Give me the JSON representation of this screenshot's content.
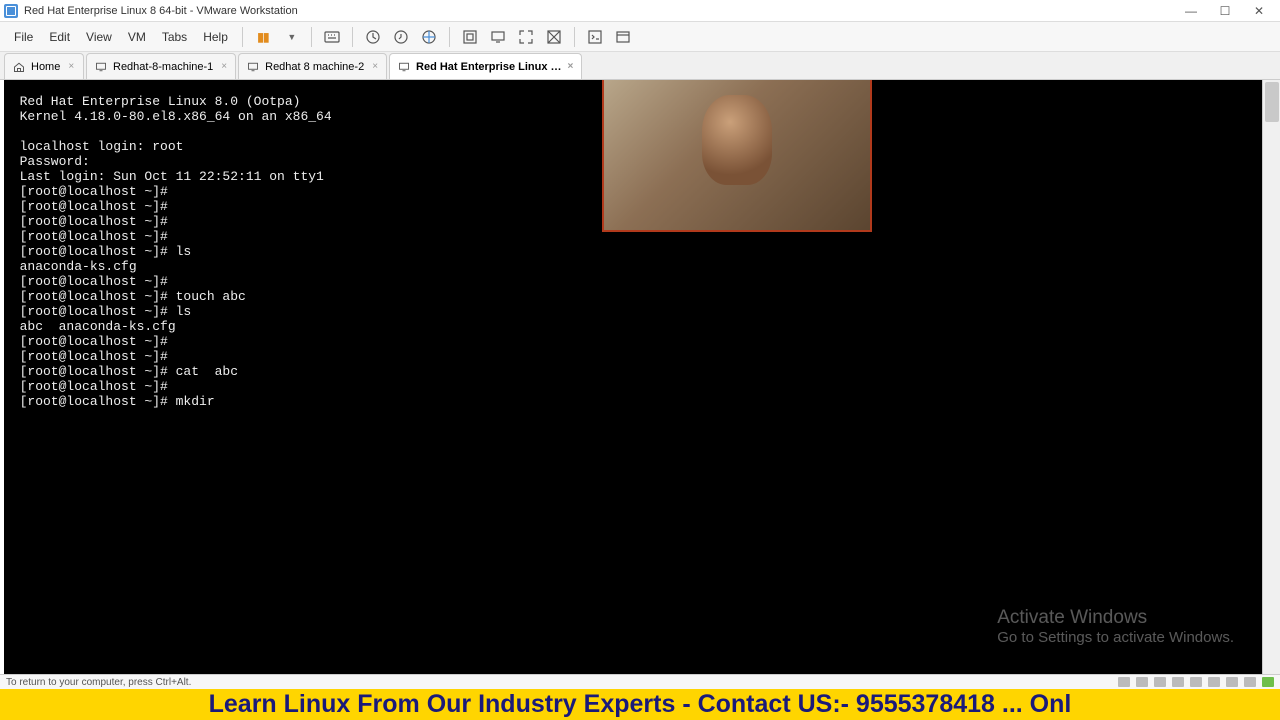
{
  "window_title": "Red Hat Enterprise Linux 8 64-bit - VMware Workstation",
  "menu": {
    "file": "File",
    "edit": "Edit",
    "view": "View",
    "vm": "VM",
    "tabs": "Tabs",
    "help": "Help"
  },
  "tabs": {
    "home": "Home",
    "t1": "Redhat-8-machine-1",
    "t2": "Redhat 8 machine-2",
    "t3": "Red Hat Enterprise Linux …"
  },
  "terminal": [
    "Red Hat Enterprise Linux 8.0 (Ootpa)",
    "Kernel 4.18.0-80.el8.x86_64 on an x86_64",
    "",
    "localhost login: root",
    "Password:",
    "Last login: Sun Oct 11 22:52:11 on tty1",
    "[root@localhost ~]#",
    "[root@localhost ~]#",
    "[root@localhost ~]#",
    "[root@localhost ~]#",
    "[root@localhost ~]# ls",
    "anaconda-ks.cfg",
    "[root@localhost ~]#",
    "[root@localhost ~]# touch abc",
    "[root@localhost ~]# ls",
    "abc  anaconda-ks.cfg",
    "[root@localhost ~]#",
    "[root@localhost ~]#",
    "[root@localhost ~]# cat  abc",
    "[root@localhost ~]#",
    "[root@localhost ~]# mkdir"
  ],
  "watermark": {
    "line1": "Activate Windows",
    "line2": "Go to Settings to activate Windows."
  },
  "status_text": "To return to your computer, press Ctrl+Alt.",
  "banner_text": "Learn Linux From Our Industry Experts - Contact US:- 9555378418 ... Onl"
}
